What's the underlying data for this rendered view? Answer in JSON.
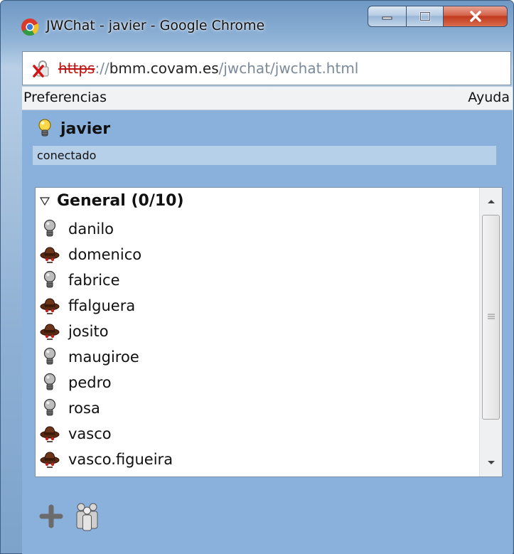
{
  "window": {
    "title": "JWChat - javier - Google Chrome",
    "address": {
      "scheme": "https",
      "separator": "://",
      "host": "bmm.covam.es",
      "path": "/jwchat/jwchat.html"
    }
  },
  "menu": {
    "left": "Preferencias",
    "right": "Ayuda"
  },
  "user": {
    "name": "javier",
    "status": "conectado"
  },
  "roster": {
    "group_label": "General (0/10)",
    "contacts": [
      {
        "name": "danilo",
        "icon": "offline-bulb-icon"
      },
      {
        "name": "domenico",
        "icon": "transport-hat-icon"
      },
      {
        "name": "fabrice",
        "icon": "offline-bulb-icon"
      },
      {
        "name": "ffalguera",
        "icon": "transport-hat-icon"
      },
      {
        "name": "josito",
        "icon": "transport-hat-icon"
      },
      {
        "name": "maugiroe",
        "icon": "offline-bulb-icon"
      },
      {
        "name": "pedro",
        "icon": "offline-bulb-icon"
      },
      {
        "name": "rosa",
        "icon": "offline-bulb-icon"
      },
      {
        "name": "vasco",
        "icon": "transport-hat-icon"
      },
      {
        "name": "vasco.figueira",
        "icon": "transport-hat-icon"
      }
    ]
  },
  "colors": {
    "panel": "#8ab0dc",
    "status_bar": "#b7d0ea",
    "scheme_error": "#c01010"
  }
}
